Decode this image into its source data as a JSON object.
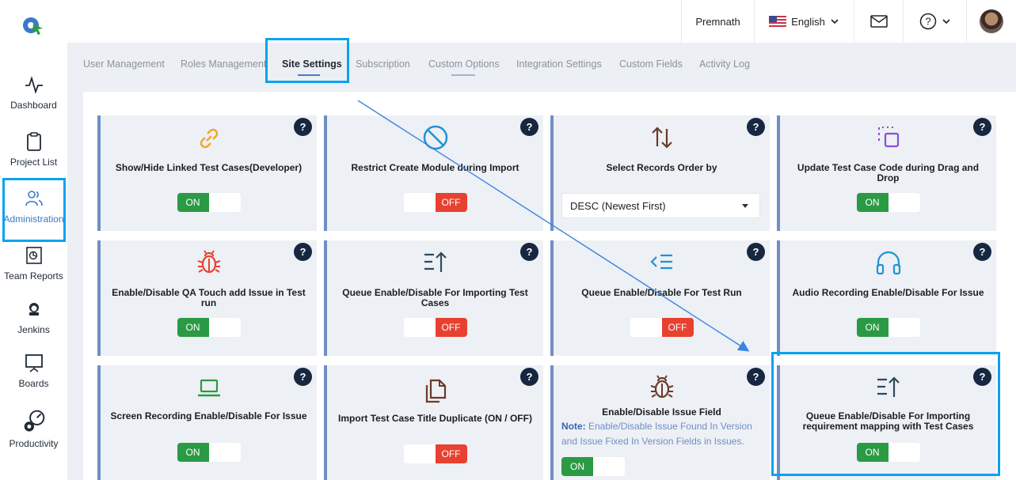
{
  "header": {
    "user_name": "Premnath",
    "language": "English",
    "icons": [
      "qa-touch-logo-icon",
      "us-flag-icon",
      "mail-icon",
      "help-icon",
      "avatar"
    ]
  },
  "sidebar": {
    "items": [
      {
        "label": "Dashboard",
        "icon": "activity-icon"
      },
      {
        "label": "Project List",
        "icon": "clipboard-icon"
      },
      {
        "label": "Administration",
        "icon": "users-icon",
        "active": true
      },
      {
        "label": "Team Reports",
        "icon": "report-icon"
      },
      {
        "label": "Jenkins",
        "icon": "jenkins-icon"
      },
      {
        "label": "Boards",
        "icon": "board-icon"
      },
      {
        "label": "Productivity",
        "icon": "gears-icon"
      }
    ]
  },
  "tabs": [
    "User Management",
    "Roles Management",
    "Site Settings",
    "Subscription",
    "Custom Options",
    "Integration Settings",
    "Custom Fields",
    "Activity Log"
  ],
  "active_tab": "Site Settings",
  "toggle_labels": {
    "on": "ON",
    "off": "OFF"
  },
  "help_label": "?",
  "cards": [
    {
      "title": "Show/Hide Linked Test Cases(Developer)",
      "state": "ON",
      "icon": "link-icon"
    },
    {
      "title": "Restrict Create Module during Import",
      "state": "OFF",
      "icon": "ban-icon"
    },
    {
      "title": "Select Records Order by",
      "select_value": "DESC (Newest First)",
      "icon": "sort-arrows-icon"
    },
    {
      "title": "Update Test Case Code during Drag and Drop",
      "state": "ON",
      "icon": "drag-drop-icon"
    },
    {
      "title": "Enable/Disable QA Touch add Issue in Test run",
      "state": "ON",
      "icon": "bug-icon"
    },
    {
      "title": "Queue Enable/Disable For Importing Test Cases",
      "state": "OFF",
      "icon": "sort-list-icon"
    },
    {
      "title": "Queue Enable/Disable For Test Run",
      "state": "OFF",
      "icon": "list-indent-icon"
    },
    {
      "title": "Audio Recording Enable/Disable For Issue",
      "state": "ON",
      "icon": "headphones-icon"
    },
    {
      "title": "Screen Recording Enable/Disable For Issue",
      "state": "ON",
      "icon": "laptop-icon"
    },
    {
      "title": "Import Test Case Title Duplicate (ON / OFF)",
      "state": "OFF",
      "icon": "copy-icon"
    },
    {
      "title": "Enable/Disable Issue Field",
      "state": "ON",
      "icon": "bug-icon",
      "note_label": "Note:",
      "note_text": " Enable/Disable Issue Found In Version and Issue Fixed In Version Fields in Issues."
    },
    {
      "title": "Queue Enable/Disable For Importing requirement mapping with Test Cases",
      "state": "ON",
      "icon": "sort-list-icon"
    }
  ],
  "colors": {
    "accent_blue": "#0aa2ef",
    "on_green": "#2b9a45",
    "off_red": "#e8412f",
    "help_navy": "#172741",
    "card_border": "#6f8fc4"
  }
}
